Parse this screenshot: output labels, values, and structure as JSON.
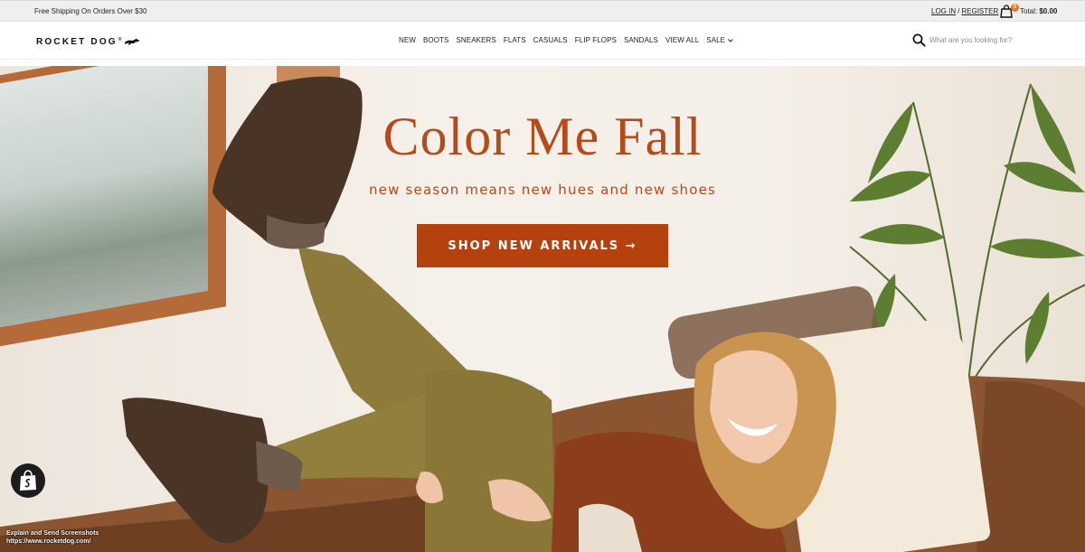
{
  "announcement": {
    "shipping_text": "Free Shipping On Orders Over $30",
    "login_label": "LOG IN",
    "separator": "/",
    "register_label": "REGISTER"
  },
  "cart": {
    "icon": "shopping-bag-icon",
    "count": "0",
    "total_label": "Total:",
    "total_value": "$0.00",
    "badge_color": "#e07a24"
  },
  "header": {
    "logo_text": "ROCKET DOG",
    "logo_reg": "®",
    "logo_icon": "running-dog-icon",
    "nav": [
      "NEW",
      "BOOTS",
      "SNEAKERS",
      "FLATS",
      "CASUALS",
      "FLIP FLOPS",
      "SANDALS",
      "VIEW ALL",
      "SALE"
    ],
    "search_placeholder": "What are you looking for?"
  },
  "hero": {
    "headline": "Color Me Fall",
    "subline": "new season means new hues and new shoes",
    "cta_label": "SHOP NEW ARRIVALS →",
    "accent_color": "#b5410f"
  },
  "overlay": {
    "shopify_icon": "shopify-bag-icon",
    "watermark_line1": "Explain and Send Screenshots",
    "watermark_line2": "https://www.rocketdog.com/"
  }
}
